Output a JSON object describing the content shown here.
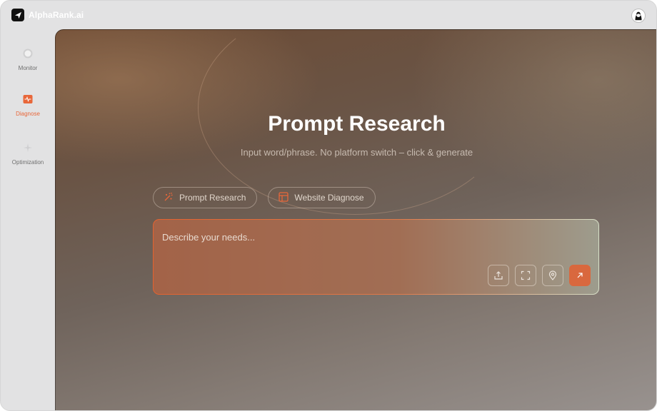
{
  "app": {
    "name": "AlphaRank.ai"
  },
  "colors": {
    "accent": "#e8673a",
    "sidebar_bg": "#e2e2e3"
  },
  "sidebar": {
    "items": [
      {
        "label": "Monitor",
        "icon": "monitor-icon",
        "active": false
      },
      {
        "label": "Diagnose",
        "icon": "diagnose-icon",
        "active": true
      },
      {
        "label": "Optimization",
        "icon": "sparkle-icon",
        "active": false
      }
    ]
  },
  "hero": {
    "title": "Prompt Research",
    "subtitle": "Input word/phrase. No platform switch – click & generate"
  },
  "tabs": [
    {
      "label": "Prompt Research",
      "icon": "magic-wand-icon"
    },
    {
      "label": "Website Diagnose",
      "icon": "layout-icon"
    }
  ],
  "prompt": {
    "placeholder": "Describe your needs...",
    "value": ""
  },
  "tools": [
    "upload-icon",
    "expand-icon",
    "location-pin-icon",
    "send-arrow-icon"
  ]
}
